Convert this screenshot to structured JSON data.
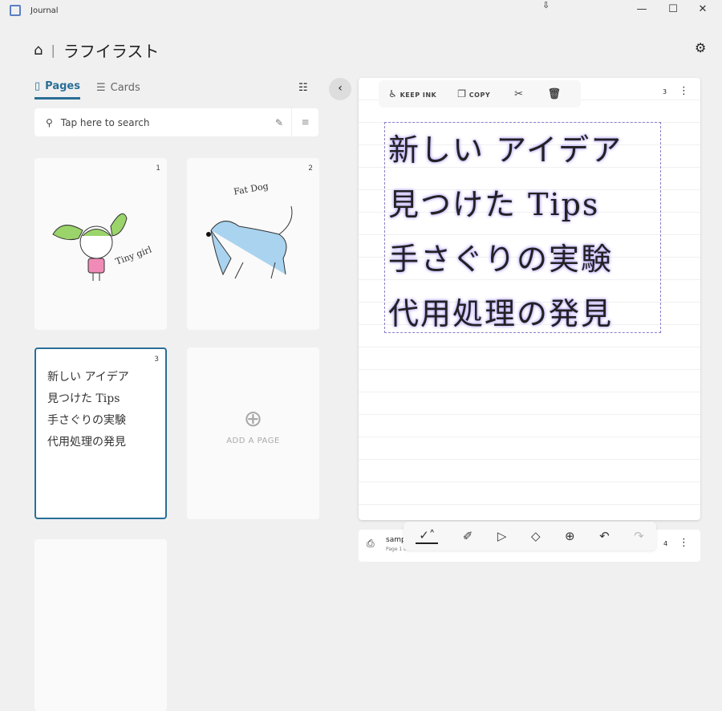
{
  "window": {
    "title": "Journal",
    "min": "—",
    "max": "☐",
    "close": "✕"
  },
  "breadcrumb": {
    "title": "ラフイラスト"
  },
  "tabs": [
    {
      "label": "Pages"
    },
    {
      "label": "Cards"
    }
  ],
  "search": {
    "placeholder": "Tap here to search"
  },
  "pages": [
    {
      "num": "1",
      "caption": "Tiny girl"
    },
    {
      "num": "2",
      "caption": "Fat Dog"
    },
    {
      "num": "3",
      "lines": [
        "新しい アイデア",
        "見つけた Tips",
        "手さぐりの実験",
        "代用処理の発見"
      ]
    }
  ],
  "add_page": {
    "label": "ADD A PAGE"
  },
  "context_toolbar": {
    "keep_ink": "KEEP INK",
    "copy": "COPY"
  },
  "editor": {
    "page_num": "3",
    "ink_lines": [
      "新しい アイデア",
      "見つけた Tips",
      "手さぐりの実験",
      "代用処理の発見"
    ]
  },
  "next_doc": {
    "name": "samp",
    "sub": "Page 1 of 1",
    "page_num": "4"
  }
}
